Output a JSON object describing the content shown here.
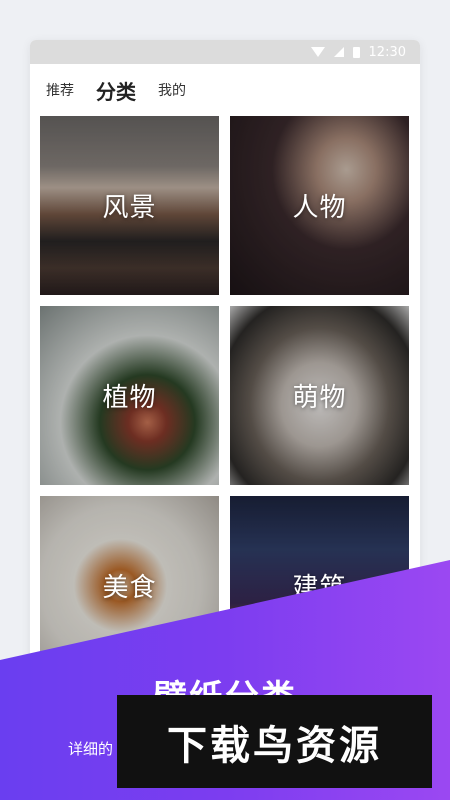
{
  "status_bar": {
    "time": "12:30",
    "icons": [
      "wifi-icon",
      "signal-icon",
      "battery-icon"
    ]
  },
  "tabs": [
    {
      "label": "推荐",
      "active": false
    },
    {
      "label": "分类",
      "active": true
    },
    {
      "label": "我的",
      "active": false
    }
  ],
  "categories": [
    {
      "label": "风景"
    },
    {
      "label": "人物"
    },
    {
      "label": "植物"
    },
    {
      "label": "萌物"
    },
    {
      "label": "美食"
    },
    {
      "label": "建筑"
    }
  ],
  "banner": {
    "title": "壁纸分类",
    "subtitle": "详细的",
    "color_start": "#6a3ef0",
    "color_end": "#9b48f2"
  },
  "watermark": {
    "text": "下载鸟资源"
  }
}
